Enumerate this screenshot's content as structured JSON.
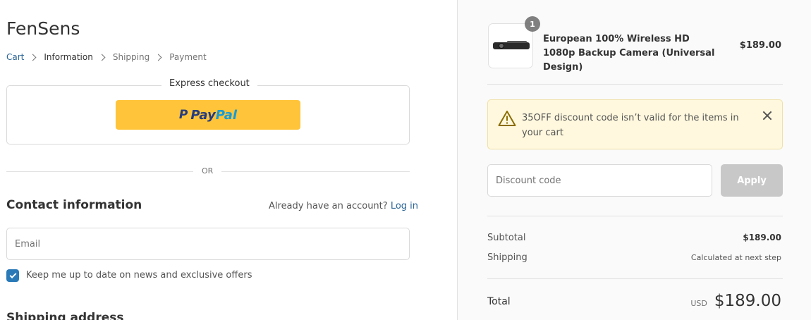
{
  "store": {
    "name": "FenSens"
  },
  "breadcrumb": {
    "items": [
      "Cart",
      "Information",
      "Shipping",
      "Payment"
    ]
  },
  "express": {
    "title": "Express checkout",
    "paypal_pay": "Pay",
    "paypal_pal": "Pal",
    "paypal_icon": "P"
  },
  "divider": {
    "or": "OR"
  },
  "contact": {
    "title": "Contact information",
    "account_prompt": "Already have an account?",
    "login_link": "Log in",
    "email_placeholder": "Email",
    "newsletter_label": "Keep me up to date on news and exclusive offers",
    "newsletter_checked": true
  },
  "shipping": {
    "title": "Shipping address"
  },
  "order": {
    "quantity": "1",
    "product_name": "European 100% Wireless HD 1080p Backup Camera (Universal Design)",
    "product_price": "$189.00"
  },
  "alert": {
    "code": "35OFF",
    "message": " discount code isn’t valid for the items in your cart"
  },
  "discount": {
    "placeholder": "Discount code",
    "apply_label": "Apply"
  },
  "summary": {
    "subtotal_label": "Subtotal",
    "subtotal_value": "$189.00",
    "shipping_label": "Shipping",
    "shipping_value": "Calculated at next step",
    "total_label": "Total",
    "currency": "USD",
    "total_value": "$189.00"
  },
  "colors": {
    "accent": "#2a6496",
    "paypal_yellow": "#ffc439",
    "paypal_dark": "#253b80",
    "paypal_light": "#179bd7",
    "alert_bg": "#fff8de",
    "checkbox": "#2a7ab8"
  }
}
